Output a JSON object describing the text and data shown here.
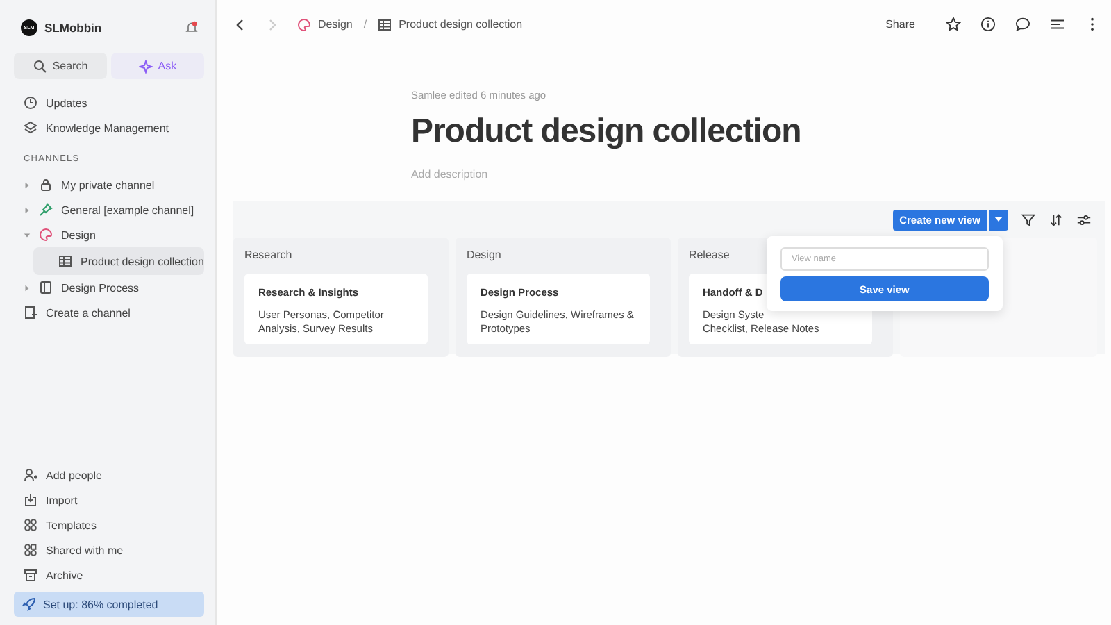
{
  "workspace": {
    "name": "SLMobbin",
    "avatar": "SLM"
  },
  "sidebar_actions": [
    {
      "label": "Search",
      "kind": "search",
      "selected": false
    },
    {
      "label": "Ask",
      "kind": "ask",
      "selected": true
    }
  ],
  "nav": [
    {
      "label": "Updates",
      "kind": "clock"
    },
    {
      "label": "Knowledge Management",
      "kind": "layers"
    }
  ],
  "channels_heading": "CHANNELS",
  "channels": [
    {
      "label": "My private channel",
      "kind": "lock",
      "expanded": false
    },
    {
      "label": "General [example channel]",
      "kind": "pin",
      "expanded": false
    },
    {
      "label": "Design",
      "kind": "palette",
      "expanded": true,
      "children": [
        {
          "label": "Product design collection",
          "kind": "table",
          "selected": true
        }
      ]
    },
    {
      "label": "Design Process",
      "kind": "doc",
      "expanded": false
    }
  ],
  "create_channel": "Create a channel",
  "bottom_nav": [
    {
      "label": "Add people",
      "kind": "person"
    },
    {
      "label": "Import",
      "kind": "import"
    },
    {
      "label": "Templates",
      "kind": "grid"
    },
    {
      "label": "Shared with me",
      "kind": "shared"
    },
    {
      "label": "Archive",
      "kind": "archive"
    }
  ],
  "setup": {
    "label": "Set up: 86% completed"
  },
  "breadcrumb": [
    "Design",
    "Product design collection"
  ],
  "breadcrumb_separator": "/",
  "share": "Share",
  "edited": "Samlee edited 6 minutes ago",
  "title": "Product design collection",
  "description": {
    "placeholder": "Add description"
  },
  "create_view": "Create new view",
  "columns": [
    {
      "name": "Research",
      "card": {
        "title": "Research & Insights",
        "lines": [
          "User Personas, Competitor",
          "Analysis, Survey Results"
        ]
      }
    },
    {
      "name": "Design",
      "card": {
        "title": "Design Process",
        "lines": [
          "Design Guidelines, Wireframes &",
          "Prototypes"
        ]
      }
    },
    {
      "name": "Release",
      "card": {
        "title": "Handoff & D",
        "lines": [
          "Design Syste",
          "Checklist, Release Notes"
        ]
      }
    }
  ],
  "popover": {
    "placeholder": "View name",
    "button": "Save view"
  }
}
